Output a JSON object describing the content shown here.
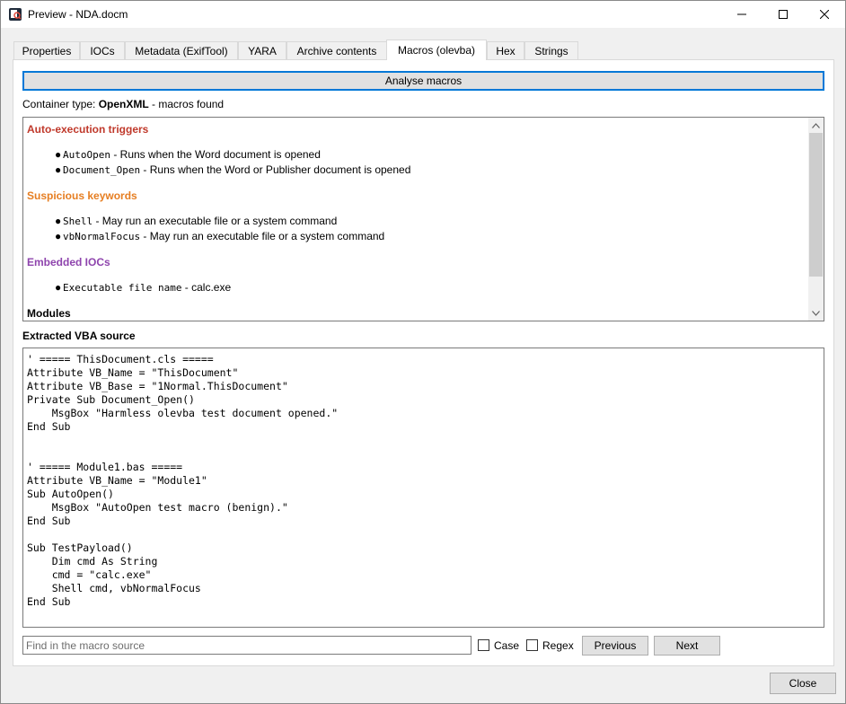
{
  "window": {
    "title": "Preview - NDA.docm",
    "icons": [
      "minimize-icon",
      "maximize-icon",
      "close-icon"
    ]
  },
  "tabs": [
    {
      "label": "Properties"
    },
    {
      "label": "IOCs"
    },
    {
      "label": "Metadata (ExifTool)"
    },
    {
      "label": "YARA"
    },
    {
      "label": "Archive contents"
    },
    {
      "label": "Macros (olevba)",
      "active": true
    },
    {
      "label": "Hex"
    },
    {
      "label": "Strings"
    }
  ],
  "analyse_button": "Analyse macros",
  "container": {
    "prefix": "Container type: ",
    "type": "OpenXML",
    "suffix": " - macros found"
  },
  "report": {
    "auto_exec": {
      "heading": "Auto-execution triggers",
      "color": "#c0392b",
      "items": [
        {
          "code": "AutoOpen",
          "desc": " - Runs when the Word document is opened"
        },
        {
          "code": "Document_Open",
          "desc": " - Runs when the Word or Publisher document is opened"
        }
      ]
    },
    "suspicious": {
      "heading": "Suspicious keywords",
      "color": "#e67e22",
      "items": [
        {
          "code": "Shell",
          "desc": " - May run an executable file or a system command"
        },
        {
          "code": "vbNormalFocus",
          "desc": " - May run an executable file or a system command"
        }
      ]
    },
    "iocs": {
      "heading": "Embedded IOCs",
      "color": "#8e44ad",
      "items": [
        {
          "code": "Executable file name",
          "desc": " - calc.exe"
        }
      ]
    },
    "modules": {
      "heading": "Modules"
    }
  },
  "vba_label": "Extracted VBA source",
  "vba_source": "' ===== ThisDocument.cls =====\nAttribute VB_Name = \"ThisDocument\"\nAttribute VB_Base = \"1Normal.ThisDocument\"\nPrivate Sub Document_Open()\n    MsgBox \"Harmless olevba test document opened.\"\nEnd Sub\n\n\n' ===== Module1.bas =====\nAttribute VB_Name = \"Module1\"\nSub AutoOpen()\n    MsgBox \"AutoOpen test macro (benign).\"\nEnd Sub\n\nSub TestPayload()\n    Dim cmd As String\n    cmd = \"calc.exe\"\n    Shell cmd, vbNormalFocus\nEnd Sub",
  "find": {
    "placeholder": "Find in the macro source",
    "value": "",
    "case_label": "Case",
    "regex_label": "Regex",
    "previous_label": "Previous",
    "next_label": "Next"
  },
  "close_label": "Close"
}
